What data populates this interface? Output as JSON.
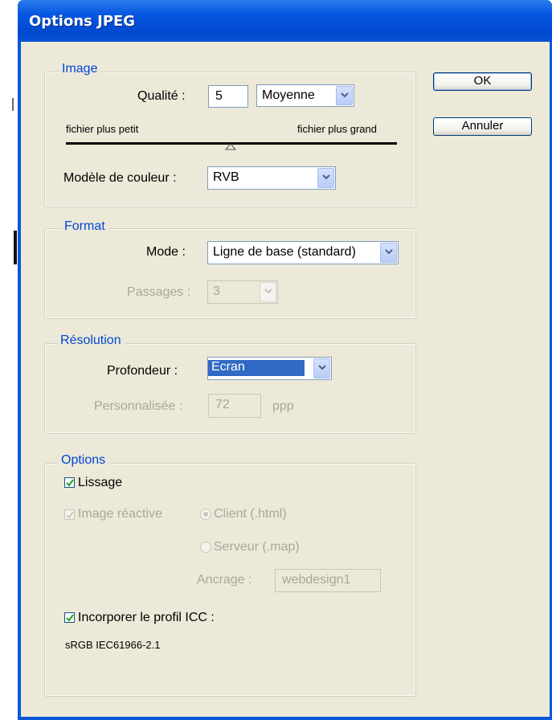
{
  "window": {
    "title": "Options JPEG"
  },
  "buttons": {
    "ok": "OK",
    "cancel": "Annuler"
  },
  "image_group": {
    "legend": "Image",
    "quality_label": "Qualité :",
    "quality_value": "5",
    "quality_preset": "Moyenne",
    "slider_min_label": "fichier plus petit",
    "slider_max_label": "fichier plus grand",
    "color_model_label": "Modèle de couleur :",
    "color_model_value": "RVB"
  },
  "format_group": {
    "legend": "Format",
    "mode_label": "Mode :",
    "mode_value": "Ligne de base (standard)",
    "passes_label": "Passages :",
    "passes_value": "3"
  },
  "resolution_group": {
    "legend": "Résolution",
    "depth_label": "Profondeur :",
    "depth_value": "Ecran",
    "custom_label": "Personnalisée :",
    "custom_value": "72",
    "custom_unit": "ppp"
  },
  "options_group": {
    "legend": "Options",
    "smoothing_label": "Lissage",
    "smoothing_checked": true,
    "imagemap_label": "Image réactive",
    "imagemap_checked": true,
    "client_label": "Client (.html)",
    "server_label": "Serveur (.map)",
    "anchor_label": "Ancrage :",
    "anchor_value": "webdesign1",
    "icc_label": "Incorporer le profil ICC :",
    "icc_checked": true,
    "icc_profile": "sRGB IEC61966-2.1"
  },
  "colors": {
    "accent": "#0046d5",
    "titlebar": "#0556e0",
    "face": "#ece9d8"
  }
}
